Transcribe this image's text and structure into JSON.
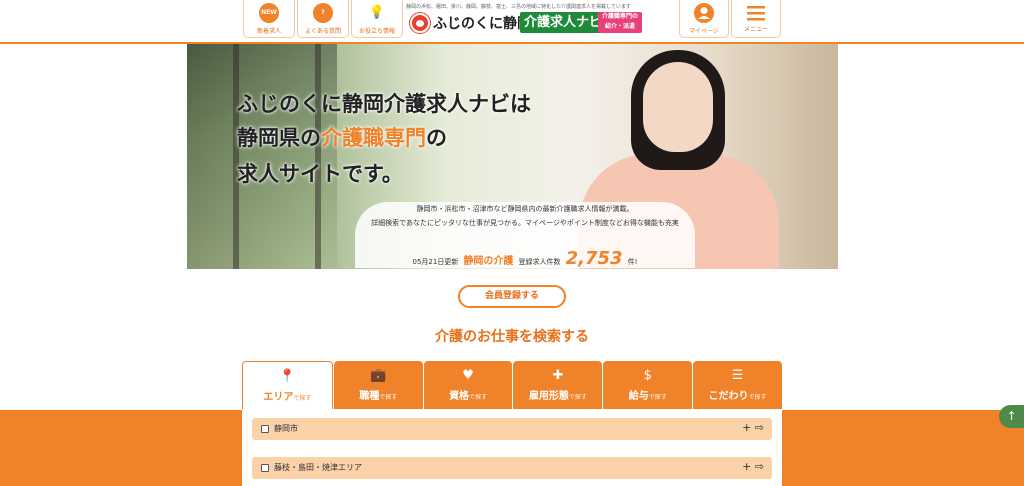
{
  "header": {
    "nav_left": [
      {
        "label": "新着求人",
        "icon": "new-badge-icon",
        "glyph": "NEW"
      },
      {
        "label": "よくある質問",
        "icon": "question-bubble-icon",
        "glyph": "?"
      },
      {
        "label": "お役立ち情報",
        "icon": "lightbulb-icon",
        "glyph": "💡"
      }
    ],
    "tagline": "静岡の浜松、磐田、掛川、静岡、藤枝、富士、三島の地域に特化した介護関連求人を掲載しています",
    "logo_main": "ふじのくに静岡",
    "logo_green": "介護求人ナビ",
    "logo_pink_1": "介護職専門の",
    "logo_pink_2": "紹介・派遣",
    "nav_right": [
      {
        "label": "マイページ",
        "icon": "user-icon"
      },
      {
        "label": "メニュー",
        "icon": "hamburger-menu-icon"
      }
    ]
  },
  "hero": {
    "line1": "ふじのくに静岡介護求人ナビは",
    "line2_pre": "静岡県の",
    "line2_accent": "介護職専門",
    "line2_post": "の",
    "line3": "求人サイトです。",
    "desc1": "静岡市・浜松市・沼津市など静岡県内の最新介護職求人情報が満載。",
    "desc2": "詳細検索であなたにピッタリな仕事が見つかる。マイページやポイント制度などお得な機能も充実",
    "updated": "05月21日更新",
    "brand": "静岡の介護",
    "count_label": "登録求人件数",
    "count": "2,753",
    "count_unit": "件!"
  },
  "register_label": "会員登録する",
  "search": {
    "title": "介護のお仕事を検索する",
    "tabs": [
      {
        "main": "エリア",
        "sub": "で探す",
        "icon": "map-pin-icon",
        "glyph": "📍"
      },
      {
        "main": "職種",
        "sub": "で探す",
        "icon": "briefcase-icon",
        "glyph": "💼"
      },
      {
        "main": "資格",
        "sub": "で探す",
        "icon": "heart-icon",
        "glyph": "♥"
      },
      {
        "main": "雇用形態",
        "sub": "で探す",
        "icon": "puzzle-icon",
        "glyph": "✚"
      },
      {
        "main": "給与",
        "sub": "で探す",
        "icon": "dollar-icon",
        "glyph": "$"
      },
      {
        "main": "こだわり",
        "sub": "で探す",
        "icon": "checklist-icon",
        "glyph": "☰"
      }
    ],
    "areas": [
      {
        "label": "静岡市",
        "ctrl": "+ ⇨"
      },
      {
        "label": "藤枝・島田・焼津エリア",
        "ctrl": "+ ⇨"
      }
    ]
  },
  "scroll_top_glyph": "↑",
  "colors": {
    "accent": "#f0822a",
    "area_row": "#fbd2a8",
    "logo_green": "#1f8a3a",
    "logo_pink": "#e8407a"
  }
}
